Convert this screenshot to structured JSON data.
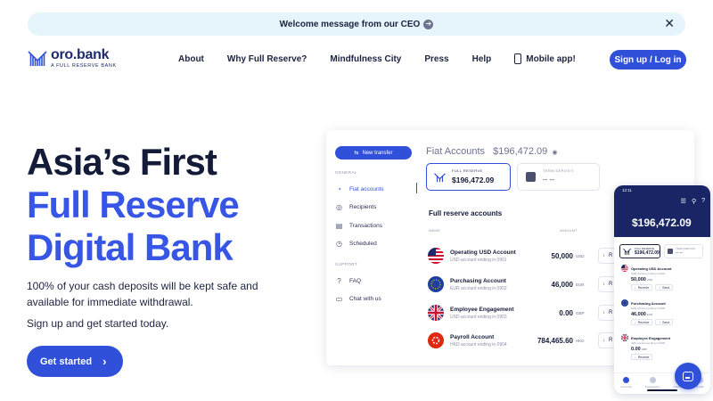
{
  "banner": {
    "text": "Welcome message from our CEO",
    "arrow_icon": "arrow-right-circle-icon",
    "close_icon": "close-icon",
    "close_glyph": "✕"
  },
  "logo": {
    "name": "oro.bank",
    "tagline": "A FULL RESERVE BANK"
  },
  "nav": {
    "items": [
      "About",
      "Why Full Reserve?",
      "Mindfulness City",
      "Press",
      "Help"
    ],
    "mobile": "Mobile app!",
    "signup": "Sign up / Log in"
  },
  "hero": {
    "title_line1": "Asia’s First",
    "title_line2": "Full Reserve",
    "title_line3": "Digital Bank",
    "subtitle": "100% of your cash deposits will be kept safe and available for immediate withdrawal.",
    "subtitle2": "Sign up and get started today.",
    "cta": "Get started",
    "cta_chevron": "›"
  },
  "colors": {
    "primary": "#3150d9",
    "navy": "#1a2565",
    "dark_text": "#131b38",
    "banner_bg": "#e6f4fb"
  },
  "app": {
    "new_transfer": "New transfer",
    "new_transfer_icon": "⇆",
    "general_heading": "GENERAL",
    "support_heading": "SUPPORT",
    "general_items": [
      {
        "label": "Fiat accounts",
        "icon": "◔"
      },
      {
        "label": "Recipients",
        "icon": "◎"
      },
      {
        "label": "Transactions",
        "icon": "▤"
      },
      {
        "label": "Scheduled",
        "icon": "◷"
      }
    ],
    "support_items": [
      {
        "label": "FAQ",
        "icon": "?"
      },
      {
        "label": "Chat with us",
        "icon": "▭"
      }
    ],
    "header_title": "Fiat Accounts",
    "header_amount": "$196,472.09",
    "header_eye": "◉",
    "full_reserve_label": "FULL RESERVE",
    "full_reserve_amount": "$196,472.09",
    "term_deposit_label": "TERM DEPOSIT",
    "term_deposit_amount": "-- --",
    "accounts_title": "Full reserve accounts",
    "col_name": "NAME",
    "col_amount": "AMOUNT",
    "accounts": [
      {
        "name": "Operating USD Account",
        "number": "USD account ending in 0901",
        "amount": "50,000",
        "currency": "USD",
        "action": "R"
      },
      {
        "name": "Purchasing Account",
        "number": "EUR account ending in 0902",
        "amount": "46,000",
        "currency": "EUR",
        "action": "R"
      },
      {
        "name": "Employee Engagement",
        "number": "USD account ending in 0903",
        "amount": "0.00",
        "currency": "GBP",
        "action": "R"
      },
      {
        "name": "Payroll Account",
        "number": "HKD account ending in 0904",
        "amount": "784,465.60",
        "currency": "HKD",
        "action": "R"
      }
    ]
  },
  "phone": {
    "time": "12:11",
    "icons": [
      "☰",
      "⚲",
      "?"
    ],
    "header_amount": "$196,472.09",
    "full_reserve_label": "FULL RESERVE",
    "full_reserve_amount": "$196,472.09",
    "term_deposit_label": "TERM DEPOSIT",
    "term_deposit_amount": "-- --",
    "accounts": [
      {
        "name": "Operating USD Account",
        "number": "USD account ending in 0901",
        "amount": "50,000",
        "currency": "USD"
      },
      {
        "name": "Purchasing Account",
        "number": "EUR account ending in 0902",
        "amount": "46,000",
        "currency": "EUR"
      },
      {
        "name": "Employee Engagement",
        "number": "USD account ending in 0903",
        "amount": "0.00",
        "currency": "GBP"
      }
    ],
    "receive": "Receive",
    "send": "Send",
    "nav": [
      "Accounts",
      "Transactions",
      "Transfer",
      "Profile"
    ]
  },
  "chat": {
    "icon": "chat-icon"
  }
}
